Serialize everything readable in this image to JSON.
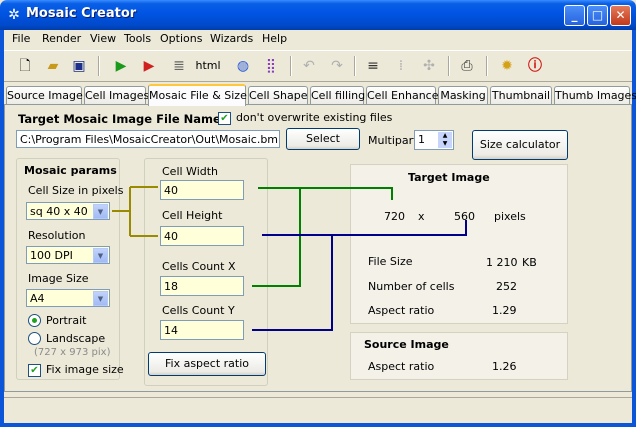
{
  "window": {
    "title": "Mosaic Creator"
  },
  "menu": [
    "File",
    "Render",
    "View",
    "Tools",
    "Options",
    "Wizards",
    "Help"
  ],
  "toolbar": {
    "html_label": "html"
  },
  "tabs": [
    "Source Image",
    "Cell Images",
    "Mosaic File & Size",
    "Cell Shape",
    "Cell filling",
    "Cell Enhance",
    "Masking",
    "Thumbnail",
    "Thumb Images"
  ],
  "active_tab": "Mosaic File & Size",
  "target_file": {
    "heading": "Target Mosaic Image File Name",
    "no_overwrite_label": "don't overwrite existing files",
    "no_overwrite_checked": true,
    "path": "C:\\Program Files\\MosaicCreator\\Out\\Mosaic.bmp",
    "select_label": "Select",
    "multipart_label": "Multipart",
    "multipart_value": "1",
    "size_calculator_label": "Size calculator"
  },
  "mosaic_params": {
    "heading": "Mosaic params",
    "cell_size_label": "Cell Size in pixels",
    "cell_size_value": "sq 40 x 40",
    "resolution_label": "Resolution",
    "resolution_value": "100 DPI",
    "image_size_label": "Image Size",
    "image_size_value": "A4",
    "portrait_label": "Portrait",
    "landscape_label": "Landscape",
    "orientation": "Portrait",
    "dims_hint": "(727 x 973 pix)",
    "fix_image_size_label": "Fix image size",
    "fix_image_size_checked": true
  },
  "cells": {
    "cell_width_label": "Cell Width",
    "cell_width_value": "40",
    "cell_height_label": "Cell Height",
    "cell_height_value": "40",
    "count_x_label": "Cells Count X",
    "count_x_value": "18",
    "count_y_label": "Cells Count Y",
    "count_y_value": "14",
    "fix_aspect_label": "Fix aspect ratio"
  },
  "target_image": {
    "heading": "Target Image",
    "width": "720",
    "x_sep": "x",
    "height": "560",
    "unit": "pixels",
    "file_size_label": "File Size",
    "file_size_value": "1 210",
    "file_size_unit": "KB",
    "num_cells_label": "Number of cells",
    "num_cells_value": "252",
    "aspect_label": "Aspect ratio",
    "aspect_value": "1.29"
  },
  "source_image": {
    "heading": "Source Image",
    "aspect_label": "Aspect ratio",
    "aspect_value": "1.26"
  },
  "colors": {
    "green_link": "#008000",
    "blue_link": "#00008B",
    "olive_link": "#9A8A00",
    "yellow_field": "#FFFFD9"
  }
}
